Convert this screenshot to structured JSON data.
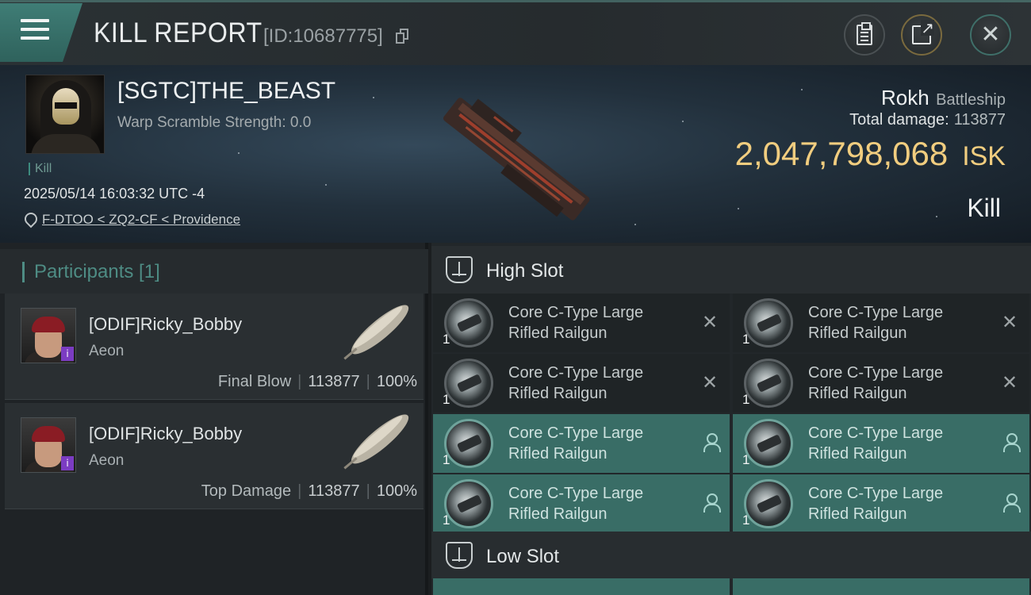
{
  "topbar": {
    "title": "KILL REPORT",
    "report_id": "[ID:10687775]",
    "menu_icon": "hamburger-menu-icon",
    "buttons": [
      {
        "name": "clipboard-button",
        "icon": "clipboard-icon"
      },
      {
        "name": "share-button",
        "icon": "share-icon"
      },
      {
        "name": "close-button",
        "icon": "close-icon"
      }
    ]
  },
  "victim": {
    "name": "[SGTC]THE_BEAST",
    "warp_scramble": "Warp Scramble Strength: 0.0",
    "tag": "Kill",
    "timestamp": "2025/05/14 16:03:32 UTC -4",
    "location": "F-DTOO < ZQ2-CF < Providence",
    "ship_name": "Rokh",
    "ship_class": "Battleship",
    "total_damage_label": "Total damage:",
    "total_damage_value": "113877",
    "isk_value": "2,047,798,068",
    "isk_unit": "ISK",
    "result": "Kill"
  },
  "participants": {
    "title": "Participants [1]",
    "cards": [
      {
        "name": "[ODIF]Ricky_Bobby",
        "ship": "Aeon",
        "role": "Final Blow",
        "damage": "113877",
        "percent": "100%"
      },
      {
        "name": "[ODIF]Ricky_Bobby",
        "ship": "Aeon",
        "role": "Top Damage",
        "damage": "113877",
        "percent": "100%"
      }
    ]
  },
  "fitting": {
    "high_slot_title": "High Slot",
    "low_slot_title": "Low Slot",
    "modules": [
      {
        "line1": "Core C-Type Large",
        "line2": "Rifled Railgun",
        "qty": "1",
        "state": "destroyed"
      },
      {
        "line1": "Core C-Type Large",
        "line2": "Rifled Railgun",
        "qty": "1",
        "state": "destroyed"
      },
      {
        "line1": "Core C-Type Large",
        "line2": "Rifled Railgun",
        "qty": "1",
        "state": "destroyed"
      },
      {
        "line1": "Core C-Type Large",
        "line2": "Rifled Railgun",
        "qty": "1",
        "state": "destroyed"
      },
      {
        "line1": "Core C-Type Large",
        "line2": "Rifled Railgun",
        "qty": "1",
        "state": "dropped"
      },
      {
        "line1": "Core C-Type Large",
        "line2": "Rifled Railgun",
        "qty": "1",
        "state": "dropped"
      },
      {
        "line1": "Core C-Type Large",
        "line2": "Rifled Railgun",
        "qty": "1",
        "state": "dropped"
      },
      {
        "line1": "Core C-Type Large",
        "line2": "Rifled Railgun",
        "qty": "1",
        "state": "dropped"
      }
    ]
  },
  "colors": {
    "accent_teal": "#3f7d76",
    "isk_gold": "#f1cd7f",
    "fitted_module": "#396d66"
  }
}
